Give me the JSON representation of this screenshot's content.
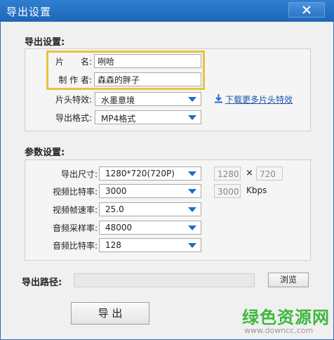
{
  "window": {
    "title": "导出设置",
    "close_icon": "close-icon"
  },
  "export_settings": {
    "section_title": "导出设置:",
    "name_label": "片　　名:",
    "name_value": "咧哈",
    "author_label": "制 作 者:",
    "author_value": "森森的胖子",
    "title_effect_label": "片头特效:",
    "title_effect_value": "水墨意境",
    "format_label": "导出格式:",
    "format_value": "MP4格式",
    "download_link": "下载更多片头特效",
    "download_icon": "download-icon"
  },
  "params": {
    "section_title": "参数设置:",
    "size_label": "导出尺寸:",
    "size_value": "1280*720(720P)",
    "width_value": "1280",
    "times_sign": "×",
    "height_value": "720",
    "video_bitrate_label": "视频比特率:",
    "video_bitrate_value": "3000",
    "video_bitrate_field": "3000",
    "kbps": "Kbps",
    "framerate_label": "视频帧速率:",
    "framerate_value": "25.0",
    "samplerate_label": "音频采样率:",
    "samplerate_value": "48000",
    "audio_bitrate_label": "音频比特率:",
    "audio_bitrate_value": "128"
  },
  "path": {
    "label": "导出路径:",
    "value": "",
    "browse": "浏览"
  },
  "export_button": "导 出",
  "watermark": {
    "main": "绿色资源网",
    "url": "www.downcc.com"
  }
}
